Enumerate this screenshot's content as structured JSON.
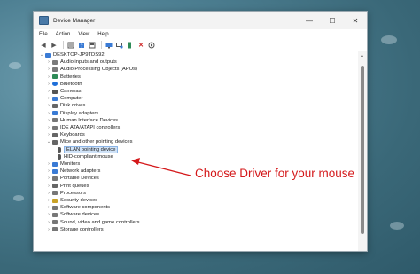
{
  "window": {
    "title": "Device Manager",
    "controls": {
      "minimize": "—",
      "maximize": "☐",
      "close": "✕"
    }
  },
  "menu": [
    "File",
    "Action",
    "View",
    "Help"
  ],
  "toolbar_icons": [
    "back-icon",
    "forward-icon",
    "properties-icon",
    "help-icon",
    "update-driver-icon",
    "display-icon",
    "scan-hardware-icon",
    "add-driver-icon",
    "uninstall-icon",
    "enable-icon"
  ],
  "tree": {
    "root": "DESKTOP-JP9TDS92",
    "items": [
      {
        "label": "Audio inputs and outputs",
        "expanded": false,
        "icon_color": "#7a7a7a"
      },
      {
        "label": "Audio Processing Objects (APOs)",
        "expanded": false,
        "icon_color": "#7a7a7a"
      },
      {
        "label": "Batteries",
        "expanded": false,
        "icon_color": "#2e8b57"
      },
      {
        "label": "Bluetooth",
        "expanded": false,
        "icon_color": "#1e6fd9"
      },
      {
        "label": "Cameras",
        "expanded": false,
        "icon_color": "#555555"
      },
      {
        "label": "Computer",
        "expanded": false,
        "icon_color": "#3a7bd5"
      },
      {
        "label": "Disk drives",
        "expanded": false,
        "icon_color": "#666666"
      },
      {
        "label": "Display adapters",
        "expanded": false,
        "icon_color": "#3a7bd5"
      },
      {
        "label": "Human Interface Devices",
        "expanded": false,
        "icon_color": "#777777"
      },
      {
        "label": "IDE ATA/ATAPI controllers",
        "expanded": false,
        "icon_color": "#777777"
      },
      {
        "label": "Keyboards",
        "expanded": false,
        "icon_color": "#666666"
      },
      {
        "label": "Mice and other pointing devices",
        "expanded": true,
        "icon_color": "#666666"
      },
      {
        "label": "ELAN pointing device",
        "child": true,
        "selected": true,
        "icon_color": "#555555"
      },
      {
        "label": "HID-compliant mouse",
        "child": true,
        "icon_color": "#555555"
      },
      {
        "label": "Monitors",
        "expanded": false,
        "icon_color": "#3a7bd5"
      },
      {
        "label": "Network adapters",
        "expanded": false,
        "icon_color": "#3a7bd5"
      },
      {
        "label": "Portable Devices",
        "expanded": false,
        "icon_color": "#777777"
      },
      {
        "label": "Print queues",
        "expanded": false,
        "icon_color": "#666666"
      },
      {
        "label": "Processors",
        "expanded": false,
        "icon_color": "#777777"
      },
      {
        "label": "Security devices",
        "expanded": false,
        "icon_color": "#c9a227"
      },
      {
        "label": "Software components",
        "expanded": false,
        "icon_color": "#777777"
      },
      {
        "label": "Software devices",
        "expanded": false,
        "icon_color": "#777777"
      },
      {
        "label": "Sound, video and game controllers",
        "expanded": false,
        "icon_color": "#777777"
      },
      {
        "label": "Storage controllers",
        "expanded": false,
        "icon_color": "#777777"
      }
    ]
  },
  "annotation": {
    "text": "Choose Driver for your mouse",
    "color": "#d4181a"
  }
}
